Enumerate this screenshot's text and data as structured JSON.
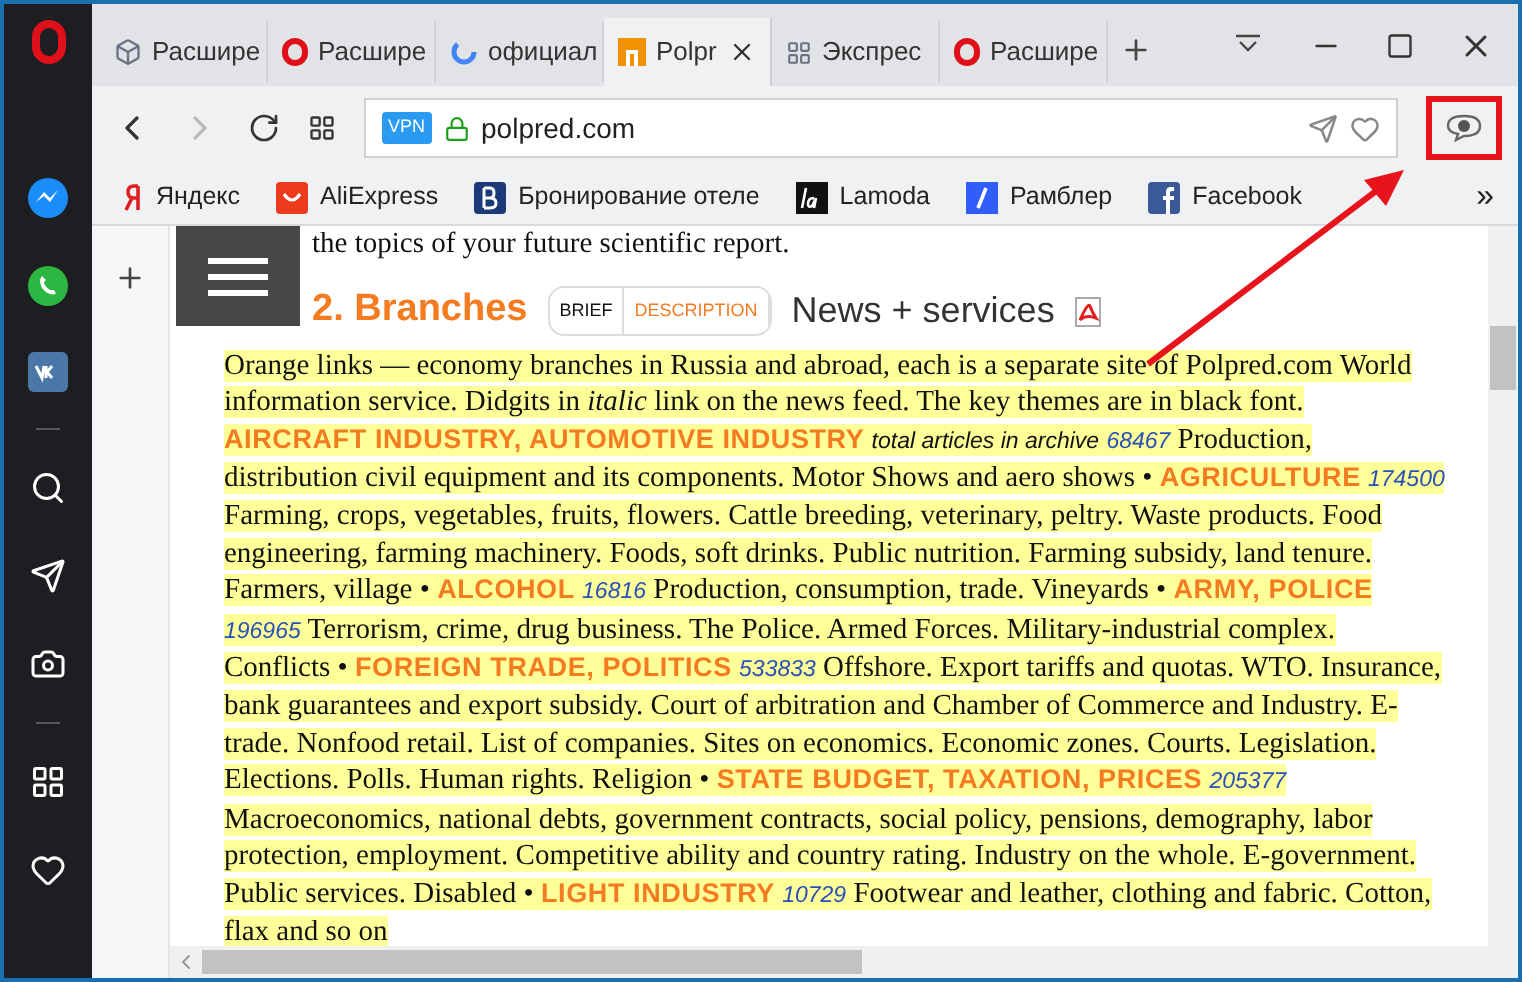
{
  "tabs": [
    {
      "label": "Расшире",
      "selected": false
    },
    {
      "label": "Расшире",
      "selected": false
    },
    {
      "label": "официал",
      "selected": false
    },
    {
      "label": "Polpr",
      "selected": true
    },
    {
      "label": "Экспрес",
      "selected": false
    },
    {
      "label": "Расшире",
      "selected": false
    }
  ],
  "address": {
    "badge": "VPN",
    "url": "polpred.com"
  },
  "bookmarks": [
    {
      "label": "Яндекс"
    },
    {
      "label": "AliExpress"
    },
    {
      "label": "Бронирование отеле"
    },
    {
      "label": "Lamoda"
    },
    {
      "label": "Рамблер"
    },
    {
      "label": "Facebook"
    }
  ],
  "bookmarks_more": "»",
  "page": {
    "top_line": "the topics of your future scientific report.",
    "heading": {
      "number": "2.",
      "title": "Branches"
    },
    "switch": [
      {
        "label": "BRIEF",
        "selected": true
      },
      {
        "label": "DESCRIPTION",
        "selected": false
      }
    ],
    "news_link": "News + services",
    "intro": "Orange links — economy branches in Russia and abroad, each is a separate site of Polpred.com World information service. Didgits in *italic* link on the news feed. The key themes are in black font.",
    "segments": [
      {
        "kind": "topic",
        "text": "AIRCRAFT INDUSTRY, AUTOMOTIVE INDUSTRY"
      },
      {
        "kind": "note",
        "text": "total articles in archive"
      },
      {
        "kind": "count",
        "text": "68467"
      },
      {
        "kind": "text",
        "text": "Production, distribution civil equipment and its components. Motor Shows and aero shows •"
      },
      {
        "kind": "topic",
        "text": "AGRICULTURE"
      },
      {
        "kind": "count",
        "text": "174500"
      },
      {
        "kind": "text",
        "text": "Farming, crops, vegetables, fruits, flowers. Cattle breeding, veterinary, peltry. Waste products. Food engineering, farming machinery. Foods, soft drinks. Public nutrition. Farming subsidy, land tenure. Farmers, village •"
      },
      {
        "kind": "topic",
        "text": "ALCOHOL"
      },
      {
        "kind": "count",
        "text": "16816"
      },
      {
        "kind": "text",
        "text": "Production, consumption, trade. Vineyards •"
      },
      {
        "kind": "topic",
        "text": "ARMY, POLICE"
      },
      {
        "kind": "count",
        "text": "196965"
      },
      {
        "kind": "text",
        "text": "Terrorism, crime, drug business. The Police. Armed Forces. Military-industrial complex. Conflicts •"
      },
      {
        "kind": "topic",
        "text": "FOREIGN TRADE, POLITICS"
      },
      {
        "kind": "count",
        "text": "533833"
      },
      {
        "kind": "text",
        "text": "Offshore. Export tariffs and quotas. WTO. Insurance, bank guarantees and export subsidy. Court of arbitration and Chamber of Commerce and Industry. E-trade. Nonfood retail. List of companies. Sites on economics. Economic zones. Courts. Legislation. Elections. Polls. Human rights. Religion •"
      },
      {
        "kind": "topic",
        "text": "STATE BUDGET, TAXATION, PRICES"
      },
      {
        "kind": "count",
        "text": "205377"
      },
      {
        "kind": "text",
        "text": "Macroeconomics, national debts, government contracts, social policy, pensions, demography, labor protection, employment. Competitive ability and country rating. Industry on the whole. E-government. Public services. Disabled •"
      },
      {
        "kind": "topic",
        "text": "LIGHT INDUSTRY"
      },
      {
        "kind": "count",
        "text": "10729"
      },
      {
        "kind": "text",
        "text": "Footwear and leather, clothing and fabric. Cotton, flax and so on"
      }
    ]
  }
}
